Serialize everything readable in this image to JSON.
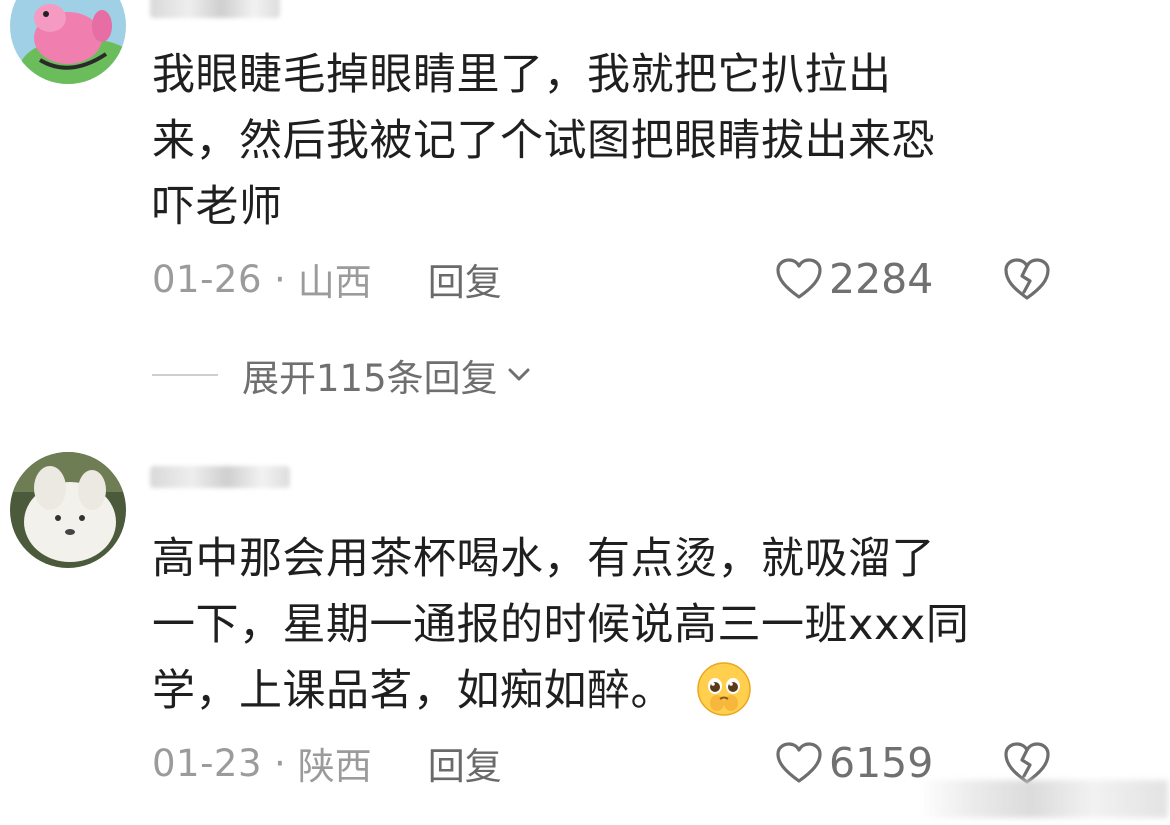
{
  "comments": [
    {
      "body_lines": [
        "我眼睫毛掉眼睛里了，我就把它扒拉出",
        "来，然后我被记了个试图把眼睛拔出来恐",
        "吓老师"
      ],
      "date": "01-26",
      "separator": "·",
      "location": "山西",
      "reply_label": "回复",
      "like_count": "2284",
      "replies_expand_label": "展开115条回复"
    },
    {
      "body_lines": [
        "高中那会用茶杯喝水，有点烫，就吸溜了",
        "一下，星期一通报的时候说高三一班xxx同",
        "学，上课品茗，如痴如醉。"
      ],
      "emoji": "pleading-face",
      "date": "01-23",
      "separator": "·",
      "location": "陕西",
      "reply_label": "回复",
      "like_count": "6159"
    }
  ],
  "icons": {
    "like": "heart-outline-icon",
    "dislike": "broken-heart-icon",
    "expand": "chevron-down-icon"
  },
  "colors": {
    "text": "#1f1f1f",
    "meta": "#9b9b9b",
    "action": "#6a6a6a"
  }
}
